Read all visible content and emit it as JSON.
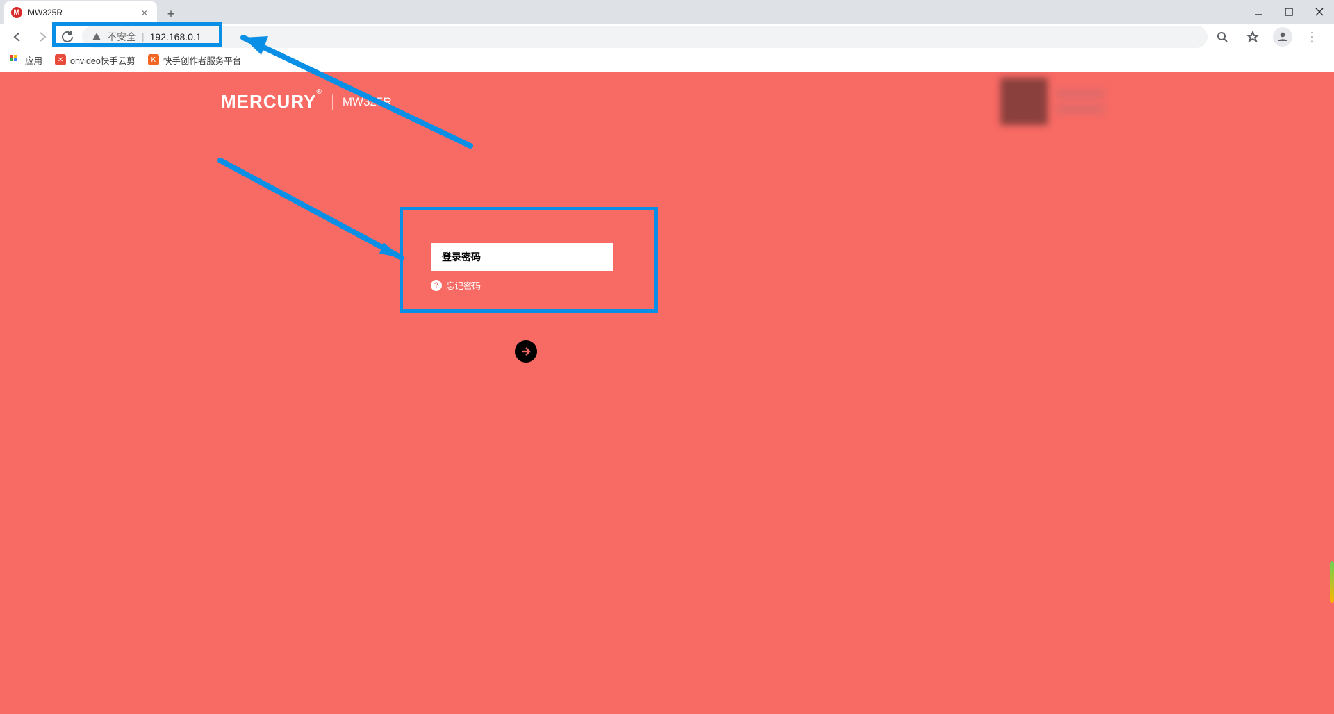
{
  "window": {
    "tab_title": "MW325R",
    "tab_favicon_letter": "M"
  },
  "toolbar": {
    "security_label": "不安全",
    "url": "192.168.0.1"
  },
  "bookmarks_bar": {
    "apps_label": "应用",
    "items": [
      {
        "label": "onvideo快手云剪"
      },
      {
        "label": "快手创作者服务平台"
      }
    ]
  },
  "page": {
    "brand": "MERCURY",
    "model": "MW325R",
    "password_placeholder": "登录密码",
    "forgot_label": "忘记密码"
  },
  "colors": {
    "page_bg": "#f86a64",
    "annotation": "#0a8fe6"
  }
}
